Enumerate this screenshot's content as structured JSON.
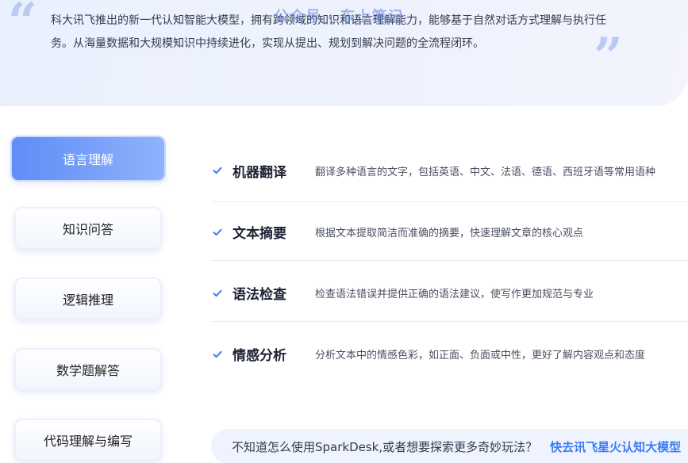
{
  "intro": {
    "text": "科大讯飞推出的新一代认知智能大模型，拥有跨领域的知识和语言理解能力，能够基于自然对话方式理解与执行任务。从海量数据和大规模知识中持续进化，实现从提出、规划到解决问题的全流程闭环。",
    "watermark": "公众号 · 东上笔记",
    "open_quote": "“",
    "close_quote": "”",
    "accent_color": "#b8cbf5"
  },
  "nav": {
    "items": [
      {
        "label": "语言理解",
        "active": true
      },
      {
        "label": "知识问答",
        "active": false
      },
      {
        "label": "逻辑推理",
        "active": false
      },
      {
        "label": "数学题解答",
        "active": false
      },
      {
        "label": "代码理解与编写",
        "active": false
      }
    ],
    "active_color": "#5f8cf8"
  },
  "features": [
    {
      "title": "机器翻译",
      "desc": "翻译多种语言的文字，包括英语、中文、法语、德语、西班牙语等常用语种",
      "icon": "check-icon"
    },
    {
      "title": "文本摘要",
      "desc": "根据文本提取简洁而准确的摘要，快速理解文章的核心观点",
      "icon": "check-icon"
    },
    {
      "title": "语法检查",
      "desc": "检查语法错误并提供正确的语法建议，使写作更加规范与专业",
      "icon": "check-icon"
    },
    {
      "title": "情感分析",
      "desc": "分析文本中的情感色彩，如正面、负面或中性，更好了解内容观点和态度",
      "icon": "check-icon"
    }
  ],
  "help": {
    "text": "不知道怎么使用SparkDesk,或者想要探索更多奇妙玩法？",
    "link": "快去讯飞星火认知大模型",
    "link_color": "#3b7cf5"
  }
}
